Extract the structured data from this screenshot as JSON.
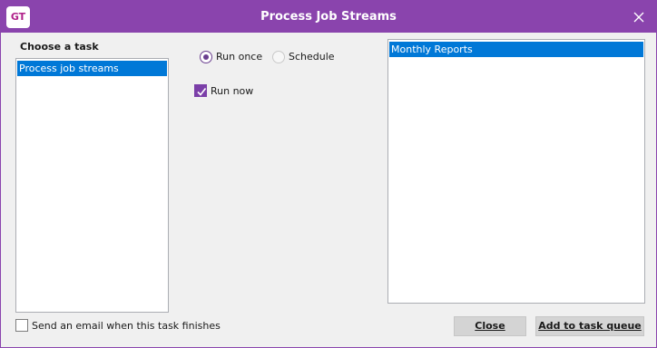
{
  "window": {
    "title": "Process Job Streams",
    "logo_text": "GT",
    "accent_color": "#8a44ad"
  },
  "tasks": {
    "heading": "Choose a task",
    "items": [
      {
        "label": "Process job streams",
        "selected": true
      }
    ]
  },
  "options": {
    "run_once_label": "Run once",
    "schedule_label": "Schedule",
    "selected": "Run once",
    "run_now_label": "Run now",
    "run_now_checked": true
  },
  "job_streams": {
    "items": [
      {
        "label": "Monthly Reports",
        "selected": true
      }
    ]
  },
  "footer": {
    "email_label": "Send an email when this task finishes",
    "email_checked": false,
    "close_label": "Close",
    "add_queue_label": "Add to task queue"
  },
  "icons": {
    "close": "close-icon",
    "checkmark": "checkmark-icon"
  }
}
